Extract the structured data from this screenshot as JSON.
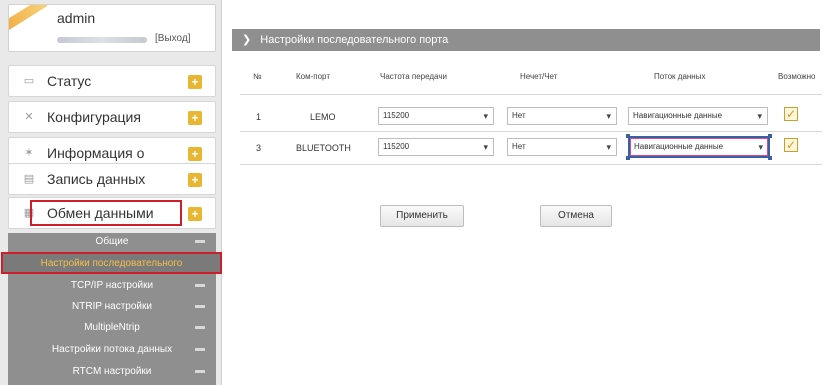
{
  "user": {
    "name": "admin",
    "logout_label": "[Выход]"
  },
  "sidebar": {
    "items": [
      {
        "label": "Статус",
        "icon": "monitor-icon"
      },
      {
        "label": "Конфигурация",
        "icon": "tools-icon"
      },
      {
        "label": "Информация о",
        "icon": "satellite-icon"
      },
      {
        "label": "Запись данных",
        "icon": "storage-icon"
      },
      {
        "label": "Обмен данными",
        "icon": "network-icon"
      }
    ],
    "subitems": [
      {
        "label": "Общие"
      },
      {
        "label": "Настройки последовательного"
      },
      {
        "label": "TCP/IP настройки"
      },
      {
        "label": "NTRIP настройки"
      },
      {
        "label": "MultipleNtrip"
      },
      {
        "label": "Настройки потока данных"
      },
      {
        "label": "RTCM настройки"
      }
    ]
  },
  "page": {
    "title": "Настройки последовательного порта"
  },
  "table": {
    "headers": [
      "№",
      "Ком-порт",
      "Частота передачи",
      "Нечет/Чет",
      "Поток данных",
      "Возможно"
    ],
    "rows": [
      {
        "num": "1",
        "port": "LEMO",
        "baud": "115200",
        "parity": "Нет",
        "stream": "Навигационные данные",
        "enabled": true
      },
      {
        "num": "3",
        "port": "BLUETOOTH",
        "baud": "115200",
        "parity": "Нет",
        "stream": "Навигационные данные",
        "enabled": true
      }
    ]
  },
  "buttons": {
    "apply": "Применить",
    "cancel": "Отмена"
  },
  "icons": {
    "chevron": "▾",
    "check": "✓",
    "plus": "+",
    "arrow": "❯"
  },
  "colors": {
    "sidebar_bg": "#e9e9e9",
    "accent_plus": "#e8b631",
    "highlight_red": "#cc1e2b",
    "highlight_blue": "#3a5fa3",
    "subnav_bg": "#8f8f8f"
  }
}
